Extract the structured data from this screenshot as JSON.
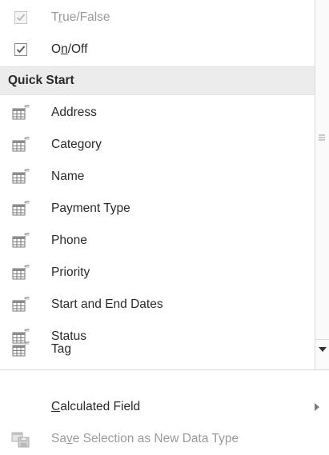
{
  "menu": {
    "bool_items": [
      {
        "label_pre": "T",
        "label_u": "r",
        "label_post": "ue/False",
        "state": "disabled",
        "icon": "checkbox-icon"
      },
      {
        "label_pre": "O",
        "label_u": "n",
        "label_post": "/Off",
        "state": "enabled",
        "icon": "checkbox-icon"
      }
    ],
    "section_header": "Quick Start",
    "quick_start_items": [
      {
        "label": "Address",
        "icon": "table-field-icon"
      },
      {
        "label": "Category",
        "icon": "table-field-icon"
      },
      {
        "label": "Name",
        "icon": "table-field-icon"
      },
      {
        "label": "Payment Type",
        "icon": "table-field-icon"
      },
      {
        "label": "Phone",
        "icon": "table-field-icon"
      },
      {
        "label": "Priority",
        "icon": "table-field-icon"
      },
      {
        "label": "Start and End Dates",
        "icon": "table-field-icon"
      },
      {
        "label": "Status",
        "icon": "table-field-icon"
      },
      {
        "label": "Tag",
        "icon": "table-field-icon"
      }
    ],
    "calculated_field": {
      "label_pre": "",
      "label_u": "C",
      "label_post": "alculated Field",
      "icon": "submenu-arrow-icon"
    },
    "save_selection": {
      "label_pre": "Sa",
      "label_u": "v",
      "label_post": "e Selection as New Data Type",
      "state": "disabled",
      "icon": "save-data-type-icon"
    }
  },
  "colors": {
    "header_bg": "#ececec",
    "disabled_text": "#9a9a9a",
    "text": "#2a2a2a"
  }
}
